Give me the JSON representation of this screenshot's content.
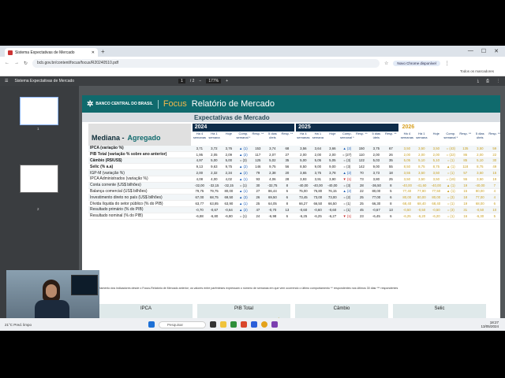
{
  "browser": {
    "tab_title": "Sistema Expectativas de Mercado",
    "url": "bcb.gov.br/content/focus/focus/R20240510.pdf",
    "chrome_pill": "Novo Chrome disponível",
    "all_bookmarks": "Todos os marcadores"
  },
  "pdf": {
    "title": "Sistema Expectativas de Mercado",
    "page": "1",
    "pages": "/ 2",
    "zoom": "177%"
  },
  "thumbs": [
    "1",
    "2"
  ],
  "report": {
    "bank": "BANCO CENTRAL DO BRASIL",
    "focus": "Focus",
    "title": "Relatório de Mercado",
    "subtitle": "Expectativas de Mercado",
    "mediana": "Mediana -",
    "agregado": "Agregado",
    "years": [
      "2024",
      "2025",
      "2026"
    ],
    "col_heads": [
      "Há 4 semanas",
      "Há 1 semana",
      "Hoje",
      "Comp. semanal *",
      "Resp. **",
      "5 dias úteis",
      "Resp. **"
    ],
    "rows": [
      {
        "label": "IPCA (variação %)",
        "bold": true,
        "y24": [
          "3,71",
          "3,72",
          "3,76",
          "▲ (1)",
          "153",
          "3,74",
          "68"
        ],
        "y25": [
          "3,56",
          "3,64",
          "3,66",
          "▲ (2)",
          "150",
          "3,75",
          "67"
        ],
        "y26": [
          "3,50",
          "3,50",
          "3,50",
          "= (43)",
          "135",
          "3,50",
          "59"
        ]
      },
      {
        "label": "PIB Total (variação % sobre ano anterior)",
        "bold": true,
        "y24": [
          "1,95",
          "2,05",
          "2,09",
          "▲ (2)",
          "117",
          "2,07",
          "27"
        ],
        "y25": [
          "2,00",
          "2,00",
          "2,00",
          "= (27)",
          "110",
          "2,00",
          "26"
        ],
        "y26": [
          "2,00",
          "2,00",
          "2,00",
          "= (22)",
          "86",
          "2,00",
          "22"
        ]
      },
      {
        "label": "Câmbio (R$/US$)",
        "bold": true,
        "y24": [
          "4,97",
          "5,00",
          "5,00",
          "= (3)",
          "125",
          "5,02",
          "35"
        ],
        "y25": [
          "5,00",
          "5,05",
          "5,05",
          "= (3)",
          "122",
          "5,03",
          "35"
        ],
        "y26": [
          "5,05",
          "5,10",
          "5,10",
          "= (1)",
          "85",
          "5,10",
          "30"
        ]
      },
      {
        "label": "Selic (% a.a)",
        "bold": true,
        "y24": [
          "9,13",
          "9,63",
          "9,75",
          "▲ (2)",
          "146",
          "9,75",
          "56"
        ],
        "y25": [
          "8,50",
          "9,00",
          "9,00",
          "= (3)",
          "142",
          "9,00",
          "55"
        ],
        "y26": [
          "8,50",
          "8,75",
          "8,75",
          "▲ (1)",
          "118",
          "8,75",
          "49"
        ]
      },
      {
        "label": "IGP-M (variação %)",
        "bold": false,
        "y24": [
          "2,00",
          "2,32",
          "2,34",
          "▲ (2)",
          "79",
          "2,38",
          "20"
        ],
        "y25": [
          "3,65",
          "3,75",
          "3,78",
          "▲ (2)",
          "70",
          "3,73",
          "18"
        ],
        "y26": [
          "3,55",
          "3,50",
          "3,50",
          "= (1)",
          "57",
          "3,50",
          "15"
        ]
      },
      {
        "label": "IPCA Administrados (variação %)",
        "bold": false,
        "y24": [
          "4,08",
          "4,00",
          "4,02",
          "▲ (1)",
          "93",
          "4,06",
          "28"
        ],
        "y25": [
          "3,93",
          "3,91",
          "3,90",
          "▼ (1)",
          "73",
          "3,80",
          "25"
        ],
        "y26": [
          "3,50",
          "3,50",
          "3,50",
          "= (19)",
          "55",
          "3,50",
          "19"
        ]
      },
      {
        "label": "Conta corrente (US$ bilhões)",
        "bold": false,
        "y24": [
          "-32,00",
          "-32,15",
          "-32,15",
          "= (1)",
          "30",
          "-32,75",
          "8"
        ],
        "y25": [
          "-40,00",
          "-40,00",
          "-40,00",
          "= (3)",
          "28",
          "-36,50",
          "8"
        ],
        "y26": [
          "-40,00",
          "-41,60",
          "-40,00",
          "▲ (1)",
          "19",
          "-40,00",
          "7"
        ]
      },
      {
        "label": "Balança comercial (US$ bilhões)",
        "bold": false,
        "y24": [
          "79,75",
          "79,75",
          "80,00",
          "▲ (1)",
          "27",
          "86,44",
          "6"
        ],
        "y25": [
          "75,00",
          "76,80",
          "76,15",
          "▲ (2)",
          "22",
          "80,00",
          "5"
        ],
        "y26": [
          "77,40",
          "77,90",
          "77,50",
          "▲ (1)",
          "15",
          "80,00",
          "4"
        ]
      },
      {
        "label": "Investimento direto no país (US$ bilhões)",
        "bold": false,
        "y24": [
          "67,00",
          "68,75",
          "69,50",
          "▲ (3)",
          "26",
          "69,50",
          "6"
        ],
        "y25": [
          "73,45",
          "73,00",
          "73,00",
          "= (2)",
          "25",
          "77,00",
          "6"
        ],
        "y26": [
          "80,00",
          "80,00",
          "80,00",
          "= (3)",
          "18",
          "77,00",
          "4"
        ]
      },
      {
        "label": "Dívida líquida do setor público (% do PIB)",
        "bold": false,
        "y24": [
          "63,77",
          "63,85",
          "63,90",
          "▲ (1)",
          "25",
          "64,05",
          "8"
        ],
        "y25": [
          "66,27",
          "66,50",
          "66,50",
          "= (1)",
          "25",
          "66,30",
          "8"
        ],
        "y26": [
          "68,40",
          "68,40",
          "68,40",
          "= (1)",
          "19",
          "68,00",
          "6"
        ]
      },
      {
        "label": "Resultado primário (% do PIB)",
        "bold": false,
        "y24": [
          "-0,70",
          "-0,67",
          "-0,64",
          "▲ (2)",
          "47",
          "-0,70",
          "13"
        ],
        "y25": [
          "-0,60",
          "-0,60",
          "-0,60",
          "= (1)",
          "45",
          "-0,67",
          "13"
        ],
        "y26": [
          "-0,50",
          "-0,50",
          "-0,50",
          "= (3)",
          "31",
          "-0,50",
          "10"
        ]
      },
      {
        "label": "Resultado nominal (% do PIB)",
        "bold": false,
        "y24": [
          "-6,88",
          "-6,80",
          "-6,80",
          "= (1)",
          "24",
          "-6,98",
          "6"
        ],
        "y25": [
          "-6,25",
          "-6,25",
          "-6,27",
          "▼ (1)",
          "23",
          "-6,45",
          "6"
        ],
        "y26": [
          "-6,25",
          "-6,20",
          "-6,20",
          "= (1)",
          "16",
          "-6,30",
          "5"
        ]
      }
    ],
    "footnote": "* comportamento dos indicadores desde o Focus-Relatório de Mercado anterior; os valores entre parênteses expressam o número de semanas em que vem ocorrendo o último comportamento  ** respondentes nos últimos 30 dias  *** respondentes",
    "charts": [
      "IPCA",
      "PIB Total",
      "Câmbio",
      "Selic"
    ]
  },
  "taskbar": {
    "weather": "21°C Pred. limpo",
    "search": "Pesquisar",
    "time": "18:27",
    "date": "13/05/2024"
  },
  "colors": {
    "banner": "#0f6a6d",
    "year_header": "#0e2d4a",
    "focus_accent": "#f2b84b",
    "y2026": "#c9a022"
  }
}
